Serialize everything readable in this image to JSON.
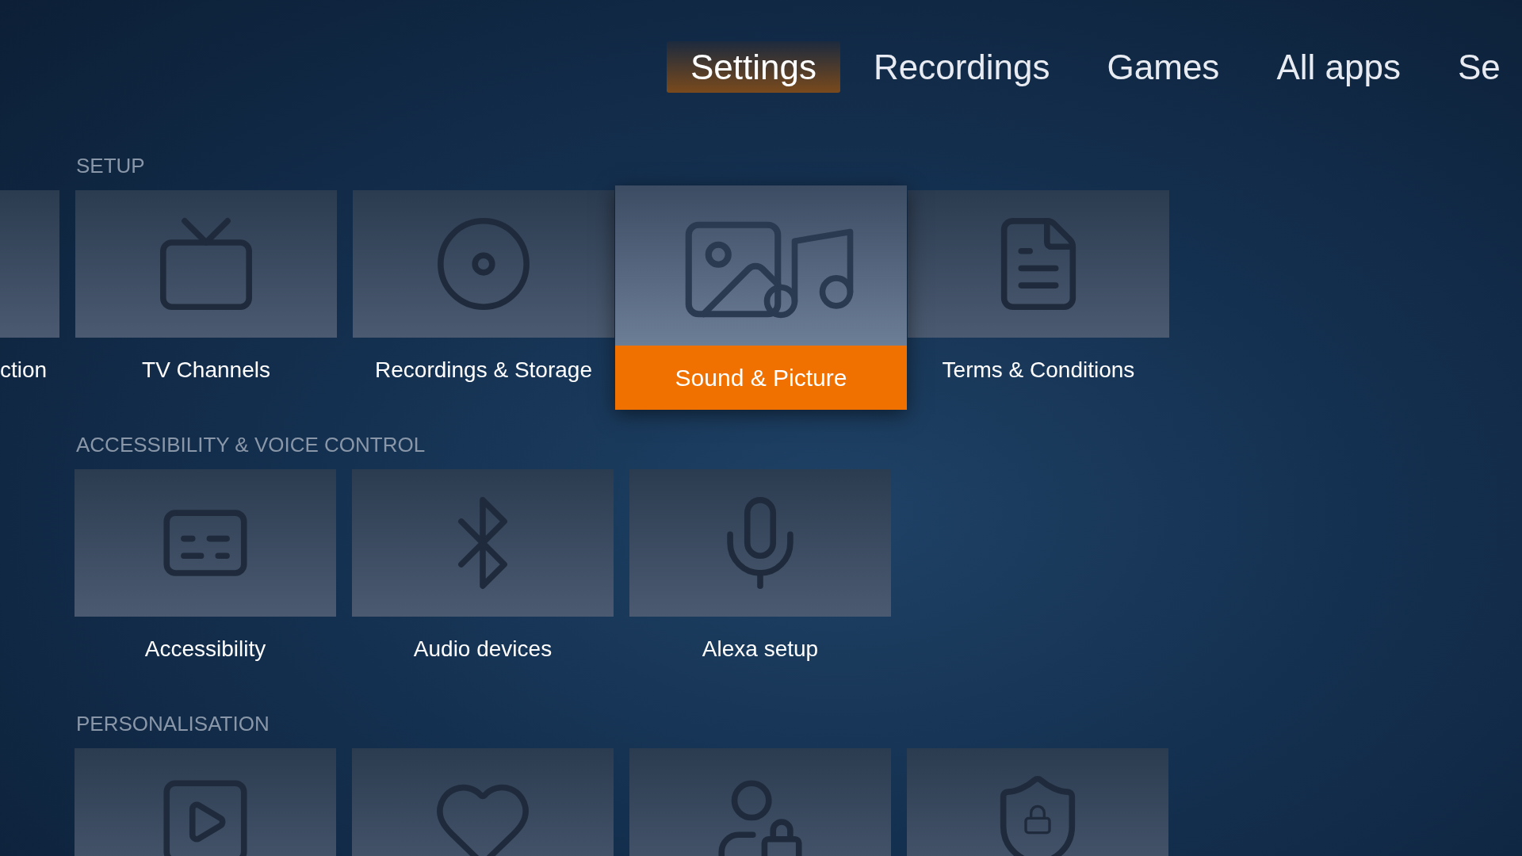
{
  "tabs": [
    {
      "label": "Settings",
      "selected": true
    },
    {
      "label": "Recordings",
      "selected": false
    },
    {
      "label": "Games",
      "selected": false
    },
    {
      "label": "All apps",
      "selected": false
    },
    {
      "label": "Se",
      "selected": false
    }
  ],
  "sections": [
    {
      "title": "SETUP",
      "tiles": [
        {
          "kind": "partial",
          "label": "ction",
          "selected": false
        },
        {
          "kind": "tile",
          "label": "TV Channels",
          "selected": false
        },
        {
          "kind": "tile",
          "label": "Recordings & Storage",
          "selected": false
        },
        {
          "kind": "tile",
          "label": "Sound & Picture",
          "selected": true
        },
        {
          "kind": "tile",
          "label": "Terms & Conditions",
          "selected": false
        }
      ]
    },
    {
      "title": "ACCESSIBILITY & VOICE CONTROL",
      "tiles": [
        {
          "kind": "tile",
          "label": "Accessibility",
          "selected": false
        },
        {
          "kind": "tile",
          "label": "Audio devices",
          "selected": false
        },
        {
          "kind": "tile",
          "label": "Alexa setup",
          "selected": false
        }
      ]
    },
    {
      "title": "PERSONALISATION",
      "tiles": [
        {
          "kind": "tile",
          "selected": false
        },
        {
          "kind": "tile",
          "selected": false
        },
        {
          "kind": "tile",
          "selected": false
        },
        {
          "kind": "tile",
          "selected": false
        }
      ]
    }
  ]
}
